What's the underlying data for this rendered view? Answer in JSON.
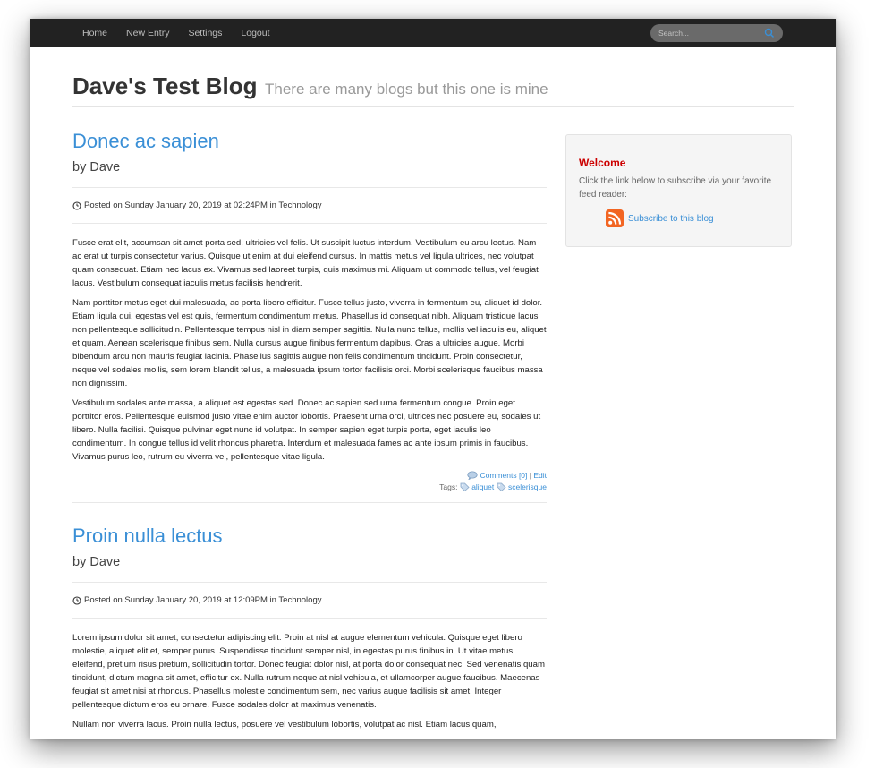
{
  "nav": {
    "links": [
      "Home",
      "New Entry",
      "Settings",
      "Logout"
    ],
    "search_placeholder": "Search..."
  },
  "site": {
    "title": "Dave's Test Blog",
    "tagline": "There are many blogs but this one is mine"
  },
  "posts": [
    {
      "title": "Donec ac sapien",
      "byline": "by Dave",
      "meta_prefix": "Posted on",
      "meta": "Posted on Sunday January 20, 2019 at 02:24PM in Technology",
      "paragraphs": [
        "Fusce erat elit, accumsan sit amet porta sed, ultricies vel felis. Ut suscipit luctus interdum. Vestibulum eu arcu lectus. Nam ac erat ut turpis consectetur varius. Quisque ut enim at dui eleifend cursus. In mattis metus vel ligula ultrices, nec volutpat quam consequat. Etiam nec lacus ex. Vivamus sed laoreet turpis, quis maximus mi. Aliquam ut commodo tellus, vel feugiat lacus. Vestibulum consequat iaculis metus facilisis hendrerit.",
        "Nam porttitor metus eget dui malesuada, ac porta libero efficitur. Fusce tellus justo, viverra in fermentum eu, aliquet id dolor. Etiam ligula dui, egestas vel est quis, fermentum condimentum metus. Phasellus id consequat nibh. Aliquam tristique lacus non pellentesque sollicitudin. Pellentesque tempus nisl in diam semper sagittis. Nulla nunc tellus, mollis vel iaculis eu, aliquet et quam. Aenean scelerisque finibus sem. Nulla cursus augue finibus fermentum dapibus. Cras a ultricies augue. Morbi bibendum arcu non mauris feugiat lacinia. Phasellus sagittis augue non felis condimentum tincidunt. Proin consectetur, neque vel sodales mollis, sem lorem blandit tellus, a malesuada ipsum tortor facilisis orci. Morbi scelerisque faucibus massa non dignissim.",
        "Vestibulum sodales ante massa, a aliquet est egestas sed. Donec ac sapien sed urna fermentum congue. Proin eget porttitor eros. Pellentesque euismod justo vitae enim auctor lobortis. Praesent urna orci, ultrices nec posuere eu, sodales ut libero. Nulla facilisi. Quisque pulvinar eget nunc id volutpat. In semper sapien eget turpis porta, eget iaculis leo condimentum. In congue tellus id velit rhoncus pharetra. Interdum et malesuada fames ac ante ipsum primis in faucibus. Vivamus purus leo, rutrum eu viverra vel, pellentesque vitae ligula."
      ],
      "comments": "Comments [0]",
      "edit": "Edit",
      "tags_label": "Tags:",
      "tags": [
        "aliquet",
        "scelerisque"
      ]
    },
    {
      "title": "Proin nulla lectus",
      "byline": "by Dave",
      "meta": "Posted on Sunday January 20, 2019 at 12:09PM in Technology",
      "paragraphs": [
        "Lorem ipsum dolor sit amet, consectetur adipiscing elit. Proin at nisl at augue elementum vehicula. Quisque eget libero molestie, aliquet elit et, semper purus. Suspendisse tincidunt semper nisl, in egestas purus finibus in. Ut vitae metus eleifend, pretium risus pretium, sollicitudin tortor. Donec feugiat dolor nisl, at porta dolor consequat nec. Sed venenatis quam tincidunt, dictum magna sit amet, efficitur ex. Nulla rutrum neque at nisl vehicula, et ullamcorper augue faucibus. Maecenas feugiat sit amet nisi at rhoncus. Phasellus molestie condimentum sem, nec varius augue facilisis sit amet. Integer pellentesque dictum eros eu ornare. Fusce sodales dolor at maximus venenatis.",
        "Nullam non viverra lacus. Proin nulla lectus, posuere vel vestibulum lobortis, volutpat ac nisl. Etiam lacus quam,"
      ]
    }
  ],
  "sidebar": {
    "title": "Welcome",
    "text": "Click the link below to subscribe via your favorite feed reader:",
    "subscribe_label": "Subscribe to this blog"
  },
  "colors": {
    "navbar": "#222222",
    "link": "#3a8fd6",
    "widget_title": "#cc0000",
    "rss": "#f26522"
  }
}
